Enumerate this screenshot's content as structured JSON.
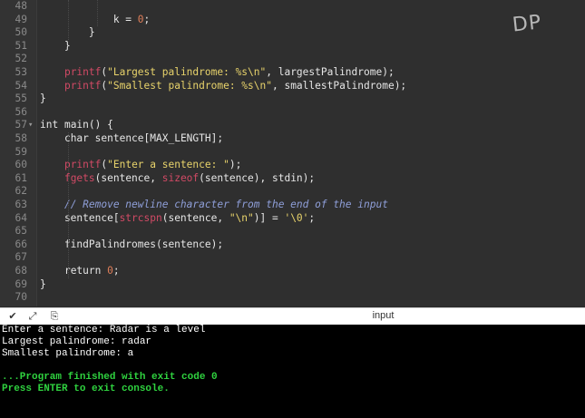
{
  "editor": {
    "lines": [
      {
        "n": "48",
        "fold": "",
        "html": ""
      },
      {
        "n": "49",
        "fold": "",
        "html": "            k = <span class='num'>0</span>;"
      },
      {
        "n": "50",
        "fold": "",
        "html": "        }"
      },
      {
        "n": "51",
        "fold": "",
        "html": "    }"
      },
      {
        "n": "52",
        "fold": "",
        "html": ""
      },
      {
        "n": "53",
        "fold": "",
        "html": "    <span class='fn'>printf</span>(<span class='str'>\"Largest palindrome: %s\\n\"</span>, largestPalindrome);"
      },
      {
        "n": "54",
        "fold": "",
        "html": "    <span class='fn'>printf</span>(<span class='str'>\"Smallest palindrome: %s\\n\"</span>, smallestPalindrome);"
      },
      {
        "n": "55",
        "fold": "",
        "html": "}"
      },
      {
        "n": "56",
        "fold": "",
        "html": ""
      },
      {
        "n": "57",
        "fold": "▾",
        "html": "<span class='kw'>int</span> main() {"
      },
      {
        "n": "58",
        "fold": "",
        "html": "    <span class='kw'>char</span> sentence[MAX_LENGTH];"
      },
      {
        "n": "59",
        "fold": "",
        "html": ""
      },
      {
        "n": "60",
        "fold": "",
        "html": "    <span class='fn'>printf</span>(<span class='str'>\"Enter a sentence: \"</span>);"
      },
      {
        "n": "61",
        "fold": "",
        "html": "    <span class='fn'>fgets</span>(sentence, <span class='fn'>sizeof</span>(sentence), stdin);"
      },
      {
        "n": "62",
        "fold": "",
        "html": ""
      },
      {
        "n": "63",
        "fold": "",
        "html": "    <span class='com'>// Remove newline character from the end of the input</span>"
      },
      {
        "n": "64",
        "fold": "",
        "html": "    sentence[<span class='fn'>strcspn</span>(sentence, <span class='str'>\"\\n\"</span>)] = <span class='str'>'\\0'</span>;"
      },
      {
        "n": "65",
        "fold": "",
        "html": ""
      },
      {
        "n": "66",
        "fold": "",
        "html": "    findPalindromes(sentence);"
      },
      {
        "n": "67",
        "fold": "",
        "html": ""
      },
      {
        "n": "68",
        "fold": "",
        "html": "    <span class='kw'>return</span> <span class='num'>0</span>;"
      },
      {
        "n": "69",
        "fold": "",
        "html": "}"
      },
      {
        "n": "70",
        "fold": "",
        "html": ""
      }
    ]
  },
  "watermark": "DP",
  "console_bar": {
    "title": "input",
    "icons": [
      "chevron-down-icon",
      "expand-icon",
      "copy-icon"
    ]
  },
  "console": {
    "lines": [
      {
        "text": "Enter a sentence: Radar is a level",
        "style": "normal"
      },
      {
        "text": "Largest palindrome: radar",
        "style": "normal"
      },
      {
        "text": "Smallest palindrome: a",
        "style": "normal"
      },
      {
        "text": "",
        "style": "normal"
      },
      {
        "text": "...Program finished with exit code 0",
        "style": "green"
      },
      {
        "text": "Press ENTER to exit console.",
        "style": "green"
      }
    ]
  }
}
